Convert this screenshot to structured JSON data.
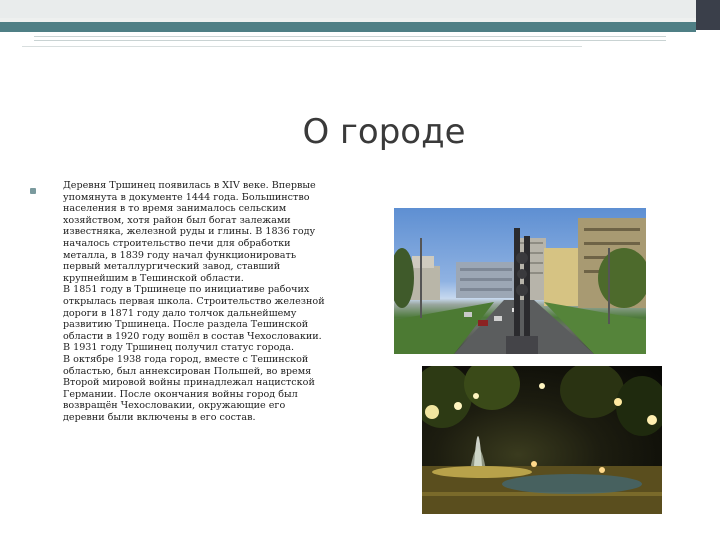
{
  "slide": {
    "title": "О городе",
    "paragraph": "Деревня Тршинец появилась в XIV веке. Впервые\nупомянута в документе 1444 года. Большинство\nнаселения в то время занималось сельским\nхозяйством, хотя район был богат залежами\nизвестняка, железной руды и глины. В 1836 году\nначалось строительство печи для обработки\nметалла, в 1839 году начал функционировать\nпервый металлургический завод, ставший\nкрупнейшим в Тешинской области.\nВ 1851 году в Тршинеце по инициативе рабочих\nоткрылась первая школа. Строительство железной\nдороги в 1871 году дало толчок дальнейшему\nразвитию Тршинеца. После раздела Тешинской\nобласти в 1920 году вошёл в состав Чехословакии.\nВ 1931 году Тршинец получил статус города.\nВ октябре 1938 года город, вместе с Тешинской\nобластью, был аннексирован Польшей, во время\nВторой мировой войны принадлежал нацистской\nГермании. После окончания войны город был\nвозвращён Чехословакии, окружающие его\nдеревни были включены в его состав."
  },
  "colors": {
    "accent_teal": "#4f7f85",
    "accent_dark": "#3a3f4a",
    "bullet": "#7a9a9e"
  }
}
